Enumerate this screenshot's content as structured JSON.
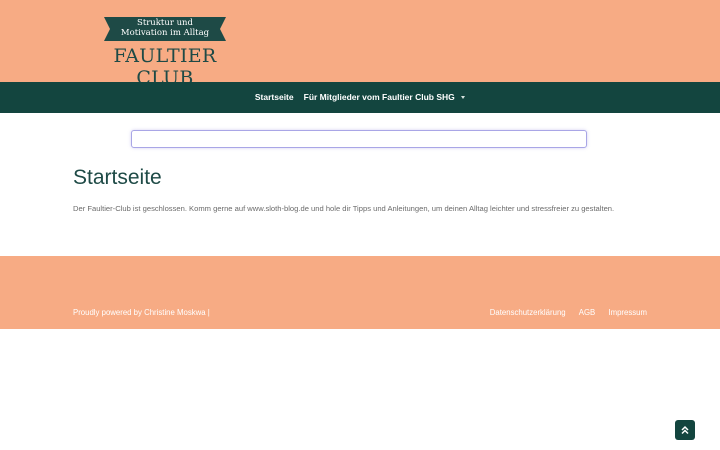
{
  "header": {
    "ribbon_line1": "Struktur und",
    "ribbon_line2": "Motivation im Alltag",
    "site_title": "FAULTIER CLUB"
  },
  "nav": {
    "items": [
      {
        "label": "Startseite"
      },
      {
        "label": "Für Mitglieder vom Faultier Club SHG",
        "icon": "chevron-down-icon"
      }
    ]
  },
  "search": {
    "value": "",
    "placeholder": ""
  },
  "main": {
    "title": "Startseite",
    "text": "Der Faultier-Club ist geschlossen. Komm gerne auf www.sloth-blog.de und hole dir Tipps und Anleitungen, um deinen Alltag leichter und stressfreier zu gestalten."
  },
  "footer": {
    "powered": "Proudly powered by Christine Moskwa |",
    "links": [
      "Datenschutzerklärung",
      "AGB",
      "Impressum"
    ]
  },
  "back_to_top": {
    "icon": "double-chevron-up-icon"
  },
  "colors": {
    "header_bg": "#f7ab84",
    "nav_bg": "#13453f",
    "title_color": "#1e4a46"
  }
}
